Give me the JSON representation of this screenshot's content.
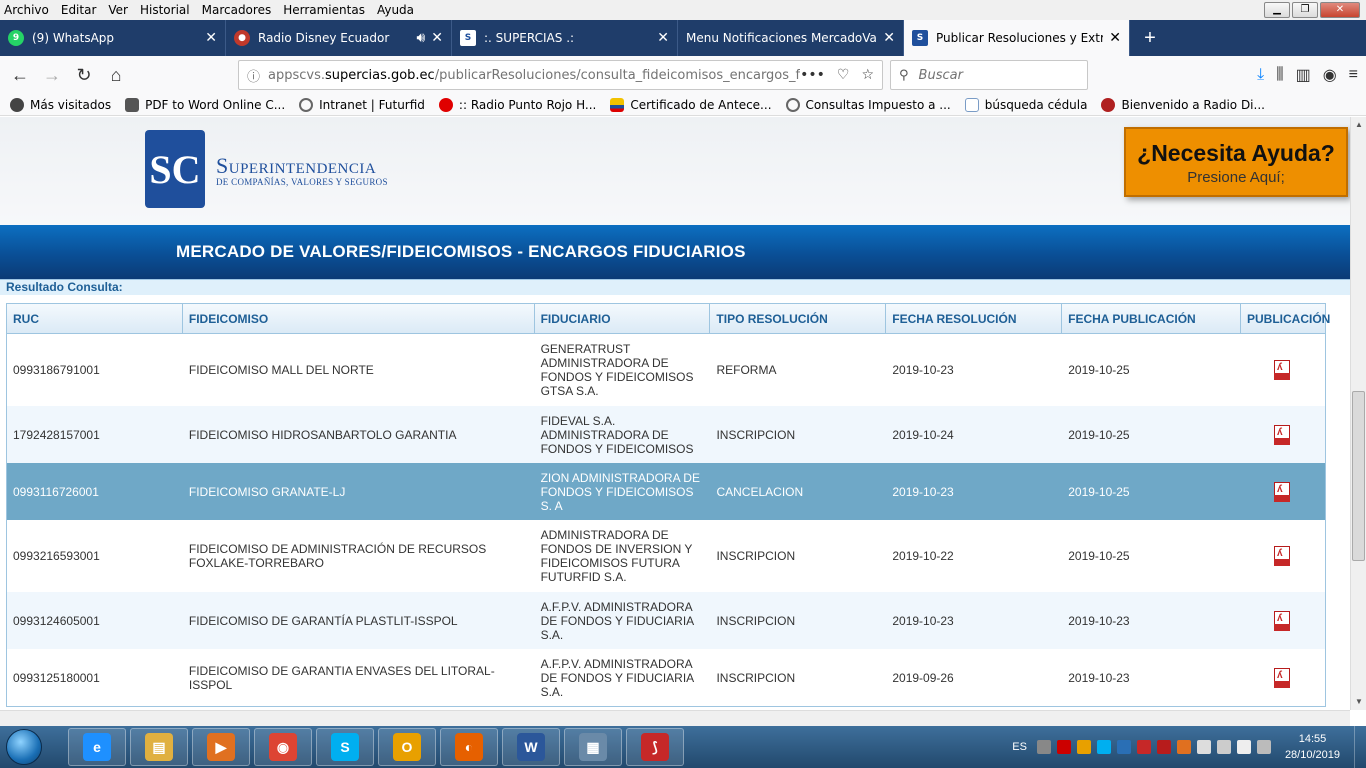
{
  "menubar": {
    "items": [
      "Archivo",
      "Editar",
      "Ver",
      "Historial",
      "Marcadores",
      "Herramientas",
      "Ayuda"
    ]
  },
  "tabs": [
    {
      "label": "(9) WhatsApp",
      "icon": "whatsapp-icon",
      "active": false
    },
    {
      "label": "Radio Disney Ecuador",
      "icon": "radio-icon",
      "active": false,
      "audio": true
    },
    {
      "label": ":. SUPERCIAS .:",
      "icon": "supercias-icon",
      "active": false
    },
    {
      "label": "Menu Notificaciones MercadoValor",
      "icon": "",
      "active": false
    },
    {
      "label": "Publicar Resoluciones y Extracto",
      "icon": "supercias-icon",
      "active": true
    }
  ],
  "nav": {
    "url_prefix": "appscvs.",
    "url_domain": "supercias.gob.ec",
    "url_path": "/publicarResoluciones/consulta_fideicomisos_encargos_fi",
    "search_placeholder": "Buscar"
  },
  "bookmarks": [
    {
      "label": "Más visitados",
      "icon": "gear-icon",
      "color": "#444"
    },
    {
      "label": "PDF to Word Online C...",
      "icon": "pdf-icon",
      "color": "#555"
    },
    {
      "label": "Intranet | Futurfid",
      "icon": "globe-icon",
      "color": "#666"
    },
    {
      "label": ":: Radio Punto Rojo H...",
      "icon": "radio-icon",
      "color": "#e00000"
    },
    {
      "label": "Certificado de Antece...",
      "icon": "flag-icon",
      "color": "#d8a000"
    },
    {
      "label": "Consultas Impuesto a ...",
      "icon": "globe-icon",
      "color": "#666"
    },
    {
      "label": "búsqueda cédula",
      "icon": "page-icon",
      "color": "#7a9cc6"
    },
    {
      "label": "Bienvenido a Radio Di...",
      "icon": "radio-icon",
      "color": "#b02020"
    }
  ],
  "header": {
    "logo_letters": "SC",
    "org_name": "Superintendencia",
    "org_subtitle": "DE COMPAÑÍAS, VALORES Y SEGUROS",
    "help_title": "¿Necesita Ayuda?",
    "help_subtitle": "Presione Aquí;"
  },
  "banner": {
    "title": "MERCADO DE VALORES/FIDEICOMISOS - ENCARGOS FIDUCIARIOS"
  },
  "results": {
    "label": "Resultado Consulta:",
    "columns": [
      "RUC",
      "FIDEICOMISO",
      "FIDUCIARIO",
      "TIPO RESOLUCIÓN",
      "FECHA RESOLUCIÓN",
      "FECHA PUBLICACIÓN",
      "PUBLICACIÓN"
    ],
    "rows": [
      {
        "ruc": "0993186791001",
        "fideicomiso": "FIDEICOMISO MALL DEL NORTE",
        "fiduciario": "GENERATRUST ADMINISTRADORA DE FONDOS Y FIDEICOMISOS GTSA S.A.",
        "tipo": "REFORMA",
        "fecha_res": "2019-10-23",
        "fecha_pub": "2019-10-25"
      },
      {
        "ruc": "1792428157001",
        "fideicomiso": "FIDEICOMISO HIDROSANBARTOLO GARANTIA",
        "fiduciario": "FIDEVAL S.A. ADMINISTRADORA DE FONDOS Y FIDEICOMISOS",
        "tipo": "INSCRIPCION",
        "fecha_res": "2019-10-24",
        "fecha_pub": "2019-10-25"
      },
      {
        "ruc": "0993116726001",
        "fideicomiso": "FIDEICOMISO GRANATE-LJ",
        "fiduciario": "ZION ADMINISTRADORA DE FONDOS Y FIDEICOMISOS S. A",
        "tipo": "CANCELACION",
        "fecha_res": "2019-10-23",
        "fecha_pub": "2019-10-25"
      },
      {
        "ruc": "0993216593001",
        "fideicomiso": "FIDEICOMISO DE ADMINISTRACIÓN DE RECURSOS FOXLAKE-TORREBARO",
        "fiduciario": "ADMINISTRADORA DE FONDOS DE INVERSION Y FIDEICOMISOS FUTURA FUTURFID S.A.",
        "tipo": "INSCRIPCION",
        "fecha_res": "2019-10-22",
        "fecha_pub": "2019-10-25"
      },
      {
        "ruc": "0993124605001",
        "fideicomiso": "FIDEICOMISO DE GARANTÍA PLASTLIT-ISSPOL",
        "fiduciario": "A.F.P.V. ADMINISTRADORA DE FONDOS Y FIDUCIARIA S.A.",
        "tipo": "INSCRIPCION",
        "fecha_res": "2019-10-23",
        "fecha_pub": "2019-10-23"
      },
      {
        "ruc": "0993125180001",
        "fideicomiso": "FIDEICOMISO DE GARANTIA ENVASES DEL LITORAL-ISSPOL",
        "fiduciario": "A.F.P.V. ADMINISTRADORA DE FONDOS Y FIDUCIARIA S.A.",
        "tipo": "INSCRIPCION",
        "fecha_res": "2019-09-26",
        "fecha_pub": "2019-10-23"
      }
    ],
    "selected_row": 2
  },
  "taskbar": {
    "apps": [
      {
        "name": "internet-explorer-icon",
        "color": "#1e90ff",
        "glyph": "e"
      },
      {
        "name": "file-explorer-icon",
        "color": "#e0b040",
        "glyph": "▤"
      },
      {
        "name": "media-player-icon",
        "color": "#e07020",
        "glyph": "▶"
      },
      {
        "name": "chrome-icon",
        "color": "#dd4433",
        "glyph": "◉"
      },
      {
        "name": "skype-icon",
        "color": "#00aff0",
        "glyph": "S"
      },
      {
        "name": "outlook-icon",
        "color": "#e8a000",
        "glyph": "O"
      },
      {
        "name": "firefox-icon",
        "color": "#e66000",
        "glyph": "◐"
      },
      {
        "name": "word-icon",
        "color": "#2b579a",
        "glyph": "W"
      },
      {
        "name": "calculator-icon",
        "color": "#6a8aa8",
        "glyph": "▦"
      },
      {
        "name": "acrobat-icon",
        "color": "#c62828",
        "glyph": "⟆"
      }
    ],
    "lang": "ES",
    "time": "14:55",
    "date": "28/10/2019"
  }
}
